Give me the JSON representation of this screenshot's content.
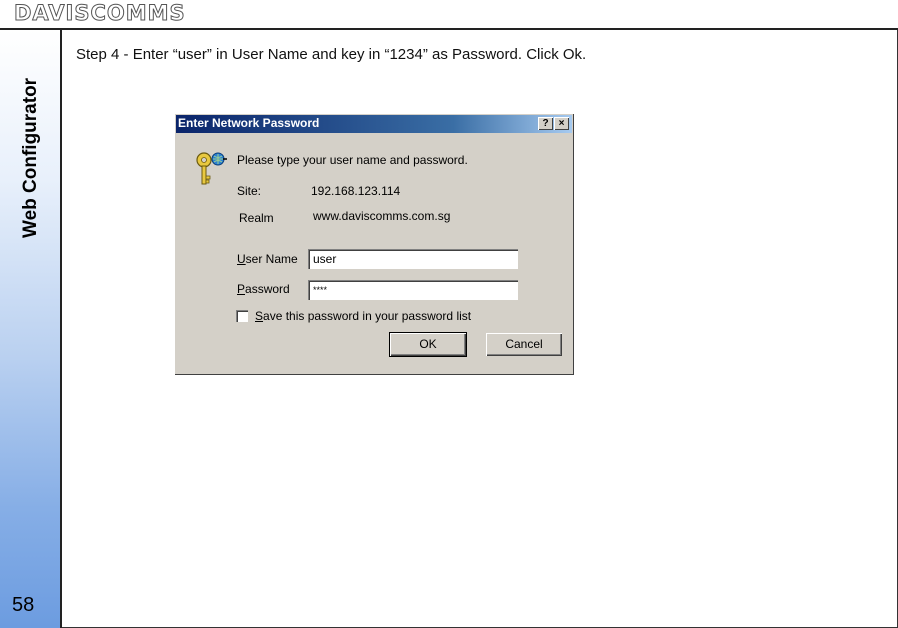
{
  "header": {
    "logo": "DAVISCOMMS"
  },
  "sidebar": {
    "section_title": "Web Configurator",
    "page_number": "58"
  },
  "main": {
    "instruction": "Step 4 - Enter “user” in User Name and key in “1234” as Password. Click Ok."
  },
  "dialog": {
    "title": "Enter Network Password",
    "help_label": "?",
    "close_label": "×",
    "prompt": "Please type your user name and password.",
    "site_label": "Site:",
    "site_value": "192.168.123.114",
    "realm_label": "Realm",
    "realm_value": "www.daviscomms.com.sg",
    "username_label_accel": "U",
    "username_label_rest": "ser Name",
    "username_value": "user",
    "password_label_accel": "P",
    "password_label_rest": "assword",
    "password_value": "****",
    "save_label_accel": "S",
    "save_label_rest": "ave this password in your password list",
    "save_checked": false,
    "ok_label": "OK",
    "cancel_label": "Cancel"
  },
  "colors": {
    "titlebar_start": "#0a246a",
    "titlebar_end": "#a6caf0",
    "dialog_face": "#d4d0c8",
    "sidebar_gradient_bottom": "#6c9ce0"
  },
  "icons": {
    "dialog_icon": "keys-icon"
  }
}
